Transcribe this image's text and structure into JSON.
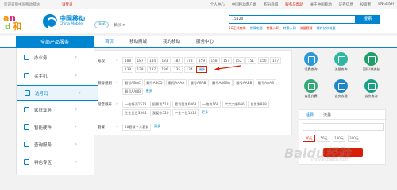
{
  "topbar": {
    "welcome": "欢迎来到中国移动网站",
    "login": "请登录",
    "links": [
      "个人中心",
      "中国移动客户端",
      "积分商城",
      "服务与帮助",
      "关于中国移动",
      "证券信息",
      "投资者",
      "ENGLISH"
    ],
    "highlight_index": 3
  },
  "header": {
    "logo_text_zh": "中国移动",
    "logo_text_en": "China Mobile",
    "ipv6": "IPv6",
    "city": "长沙 ▾",
    "search_value": "15120",
    "search_button": "搜索",
    "hotwords": [
      "5G正式商用",
      "保障电话",
      "特惠入网",
      "特惠入网",
      "流量套餐",
      "爆炸亿冰流量"
    ]
  },
  "nav": {
    "all_label": "全部产品服务",
    "items": [
      "首页",
      "移动商城",
      "我的移动",
      "服务中心"
    ]
  },
  "sidebar": {
    "items": [
      {
        "label": "办业务"
      },
      {
        "label": "买手机"
      },
      {
        "label": "选号码"
      },
      {
        "label": "家庭业务"
      },
      {
        "label": "智能硬件"
      },
      {
        "label": "查询服务"
      },
      {
        "label": "特色专区"
      }
    ],
    "active_index": 2
  },
  "panel": {
    "rows": [
      {
        "label": "号段",
        "arrow": "›",
        "options": [
          "188",
          "187",
          "184",
          "183",
          "182",
          "178",
          "159",
          "158",
          "157",
          "152",
          "151",
          "150",
          "147",
          "139",
          "138",
          "137",
          "136",
          "135",
          "134",
          "更多"
        ]
      },
      {
        "label": "靓号规则",
        "arrow": "›",
        "options": [
          "靓号ABAC",
          "靓号ABCD",
          "靓号AAAA",
          "靓号ABAB",
          "靓号AABBA",
          "靓号AABB",
          "靓号AAAB",
          "靓号AABB",
          "更多"
        ]
      },
      {
        "label": "谐音靓号",
        "arrow": "›",
        "options": [
          "一往情深1573",
          "投票发518",
          "要发要发6868",
          "一路发168",
          "六六大顺666",
          "发发发888",
          "生生世世3344",
          "我爱你520",
          "一生一世1314",
          "更多"
        ]
      },
      {
        "label": "套餐",
        "arrow": "›",
        "options": [
          "50套餐个人套餐",
          "更多"
        ]
      }
    ]
  },
  "quick": {
    "items": [
      {
        "label": "话费查询",
        "color": "#2a9ad6"
      },
      {
        "label": "流量查询",
        "color": "#2fb6a3"
      },
      {
        "label": "国际/港澳台",
        "color": "#1e9e6b"
      },
      {
        "label": "充值交费",
        "color": "#36a97b"
      },
      {
        "label": "业务办理",
        "color": "#1f85c9"
      },
      {
        "label": "业务查询",
        "color": "#17a086"
      }
    ]
  },
  "recharge": {
    "tabs": [
      "话费",
      "流量"
    ],
    "amounts": [
      "30元",
      "50元",
      "100元",
      "300元"
    ],
    "selected_amount": 0
  },
  "watermark": {
    "text": "Baidu经验",
    "sub": "jingyan.baidu.com"
  }
}
